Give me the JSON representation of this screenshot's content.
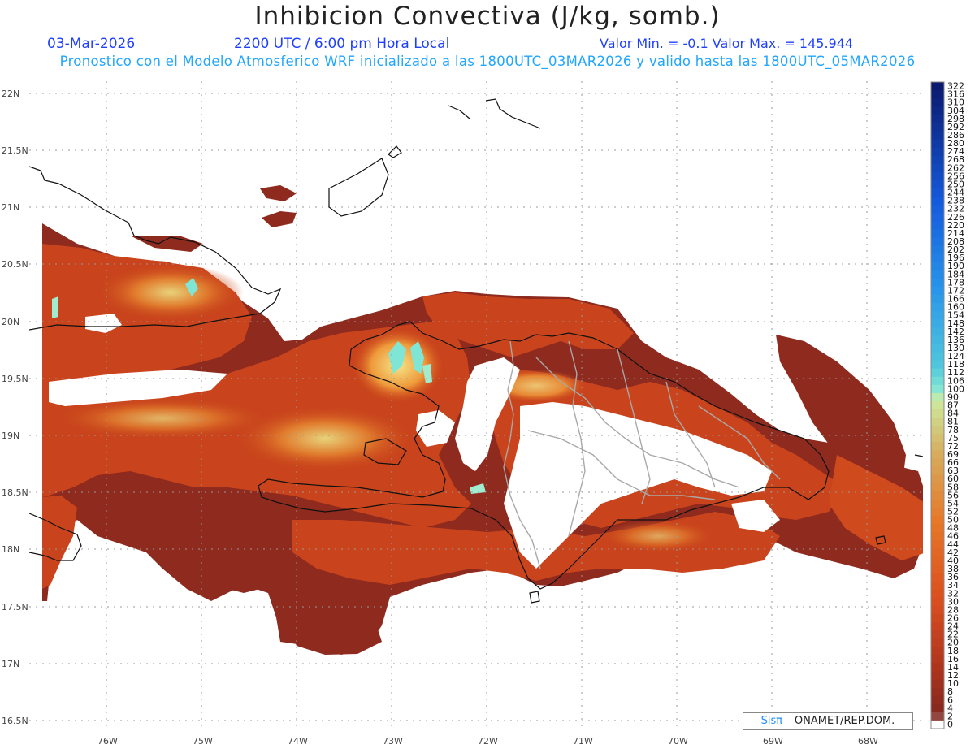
{
  "header": {
    "title": "Inhibicion Convectiva (J/kg, somb.)",
    "date": "03-Mar-2026",
    "time": "2200 UTC / 6:00 pm Hora Local",
    "minmax": "Valor Min. = -0.1  Valor Max. = 145.944",
    "model_info": "Pronostico con el Modelo Atmosferico WRF inicializado a las 1800UTC_03MAR2026 y valido hasta las  1800UTC_05MAR2026"
  },
  "map": {
    "lat_labels": [
      "22N",
      "21.5N",
      "21N",
      "20.5N",
      "20N",
      "19.5N",
      "19N",
      "18.5N",
      "18N",
      "17.5N",
      "17N",
      "16.5N"
    ],
    "lon_labels": [
      "76W",
      "75W",
      "74W",
      "73W",
      "72W",
      "71W",
      "70W",
      "69W",
      "68W"
    ],
    "regions": [
      "Cuba (east)",
      "Bahamas (Great Inagua)",
      "Haiti",
      "Dominican Republic",
      "Jamaica",
      "Puerto Rico (west)"
    ]
  },
  "colorbar": {
    "labels": [
      "322",
      "316",
      "310",
      "304",
      "298",
      "292",
      "286",
      "280",
      "274",
      "268",
      "262",
      "256",
      "250",
      "244",
      "238",
      "232",
      "226",
      "220",
      "214",
      "208",
      "202",
      "196",
      "190",
      "184",
      "178",
      "172",
      "166",
      "160",
      "154",
      "148",
      "142",
      "136",
      "130",
      "124",
      "118",
      "112",
      "106",
      "100",
      "90",
      "87",
      "84",
      "81",
      "78",
      "75",
      "72",
      "69",
      "66",
      "63",
      "60",
      "58",
      "56",
      "54",
      "52",
      "50",
      "48",
      "46",
      "44",
      "42",
      "40",
      "38",
      "36",
      "34",
      "32",
      "30",
      "28",
      "26",
      "24",
      "22",
      "20",
      "18",
      "16",
      "14",
      "12",
      "10",
      "8",
      "6",
      "4",
      "2",
      "0"
    ]
  },
  "credit": {
    "logo": "Sisπ",
    "text": "– ONAMET/REP.DOM."
  },
  "colors": {
    "high_cin": "#0a1a6e",
    "mid_cin": "#7fe6d6",
    "low_cin": "#8e2a1e",
    "field_main": "#c9441c",
    "accent_text": "#1f3fff"
  }
}
